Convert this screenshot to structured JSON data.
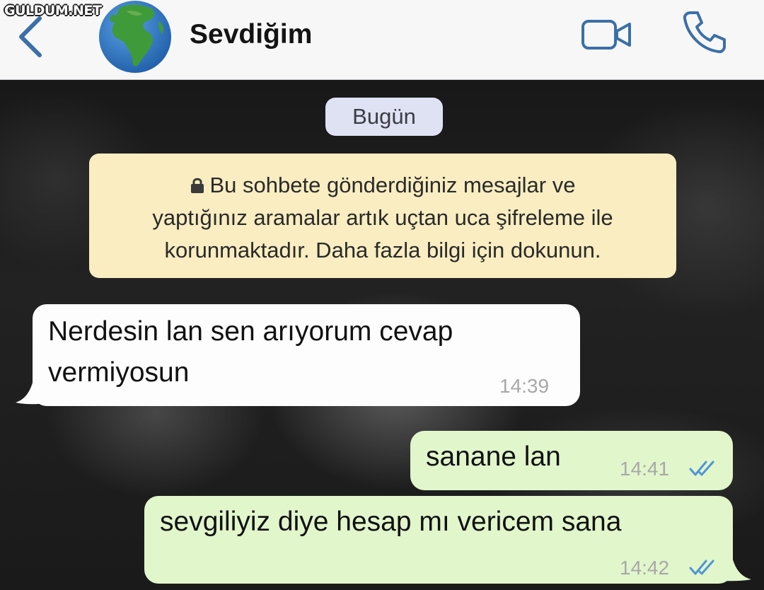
{
  "watermark": "GULDUM.NET",
  "header": {
    "contact_name": "Sevdiğim",
    "back_icon": "chevron-left-icon",
    "avatar_icon": "globe-icon",
    "video_icon": "video-camera-icon",
    "call_icon": "phone-icon"
  },
  "chat": {
    "date_label": "Bugün",
    "encryption_notice": {
      "icon": "lock-icon",
      "lines": [
        "Bu sohbete gönderdiğiniz mesajlar ve",
        "yaptığınız aramalar artık uçtan uca şifreleme ile",
        "korunmaktadır. Daha fazla bilgi için dokunun."
      ]
    },
    "messages": [
      {
        "direction": "incoming",
        "lines": [
          "Nerdesin lan sen arıyorum cevap",
          "vermiyosun"
        ],
        "time": "14:39"
      },
      {
        "direction": "outgoing",
        "lines": [
          "sanane lan"
        ],
        "time": "14:41",
        "status": "read"
      },
      {
        "direction": "outgoing",
        "lines": [
          "sevgiliyiz diye hesap mı vericem sana"
        ],
        "time": "14:42",
        "status": "read"
      }
    ]
  },
  "colors": {
    "accent": "#3b6fa8",
    "incoming_bubble": "#fdfdfd",
    "outgoing_bubble": "#e1f6cb",
    "notice_bg": "#f9edc1",
    "date_pill_bg": "#dfe2f3",
    "read_ticks": "#4f95d6"
  }
}
